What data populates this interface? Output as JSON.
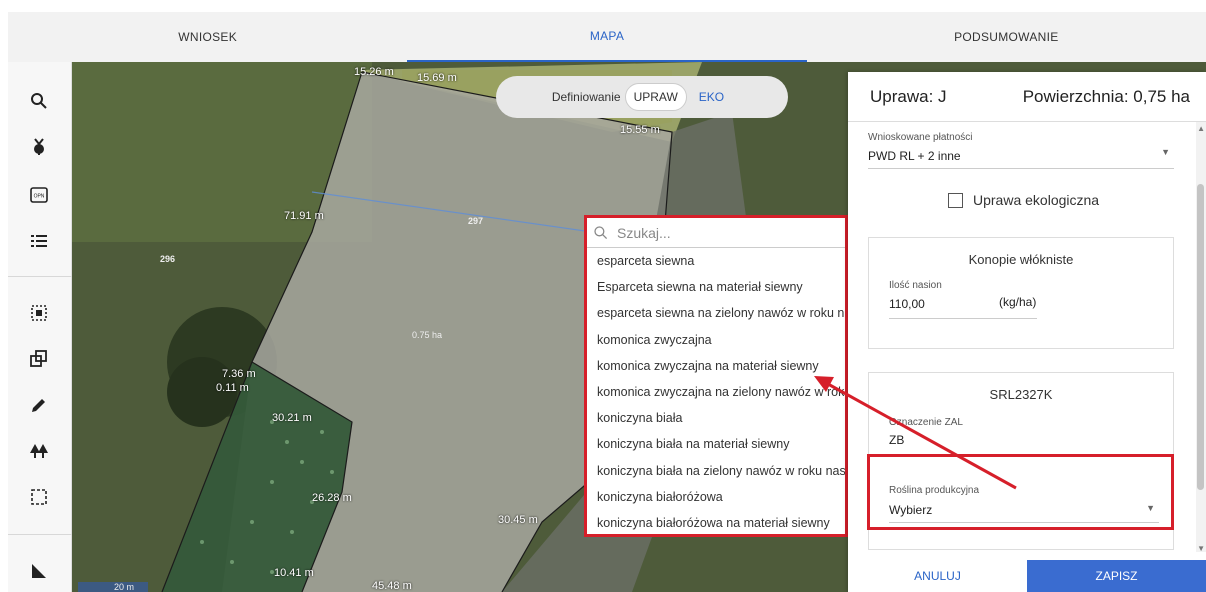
{
  "tabs": [
    {
      "label": "WNIOSEK"
    },
    {
      "label": "MAPA"
    },
    {
      "label": "PODSUMOWANIE"
    }
  ],
  "toggle": {
    "prefix": "Definiowanie",
    "upraw": "UPRAW",
    "eko": "EKO"
  },
  "map": {
    "lengths": [
      "15.26 m",
      "15.69 m",
      "15.55 m",
      "71.91 m",
      "7.36 m",
      "0.11 m",
      "30.21 m",
      "26.28 m",
      "30.45 m",
      "10.41 m",
      "45.48 m"
    ],
    "parcels": [
      "296",
      "297"
    ],
    "area": "0.75 ha",
    "scale": "20 m"
  },
  "dropdown": {
    "placeholder": "Szukaj...",
    "items": [
      "esparceta siewna",
      "Esparceta siewna na materiał siewny",
      "esparceta siewna na zielony nawóz w roku n",
      "komonica zwyczajna",
      "komonica zwyczajna na materiał siewny",
      "komonica zwyczajna na zielony nawóz w rok",
      "koniczyna biała",
      "koniczyna biała na materiał siewny",
      "koniczyna biała na zielony nawóz w roku nas",
      "koniczyna białoróżowa",
      "koniczyna białoróżowa na materiał siewny"
    ]
  },
  "panel": {
    "title": "Uprawa: J",
    "area": "Powierzchnia: 0,75 ha",
    "payments_label": "Wnioskowane płatności",
    "payments_value": "PWD RL + 2 inne",
    "eco_label": "Uprawa ekologiczna",
    "card1": {
      "title": "Konopie włókniste",
      "seed_label": "Ilość nasion",
      "seed_value": "110,00",
      "seed_unit": "(kg/ha)"
    },
    "card2": {
      "title": "SRL2327K",
      "zal_label": "Oznaczenie ZAL",
      "zal_value": "ZB",
      "plant_label": "Roślina produkcyjna",
      "plant_value": "Wybierz"
    },
    "cancel": "ANULUJ",
    "save": "ZAPISZ"
  },
  "colors": {
    "accent": "#2a64c7",
    "highlight": "#d61f2a"
  }
}
